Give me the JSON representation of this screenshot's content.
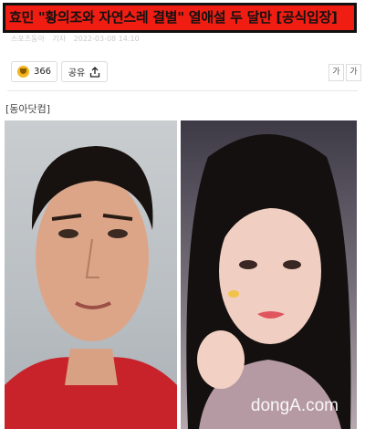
{
  "headline": "효민 \"황의조와 자연스레 결별\" 열애설 두 달만 [공식입장]",
  "meta": {
    "source": "스포츠동아",
    "author": "기자",
    "date": "2022-03-08 14:10"
  },
  "actions": {
    "like_count": "366",
    "share_label": "공유"
  },
  "font_buttons": {
    "small": "가",
    "large": "가"
  },
  "source_label": "[동아닷컴]",
  "watermark": "dongA.com",
  "colors": {
    "headline_bg": "#ef1d12",
    "like_icon": "#f4b41a"
  }
}
